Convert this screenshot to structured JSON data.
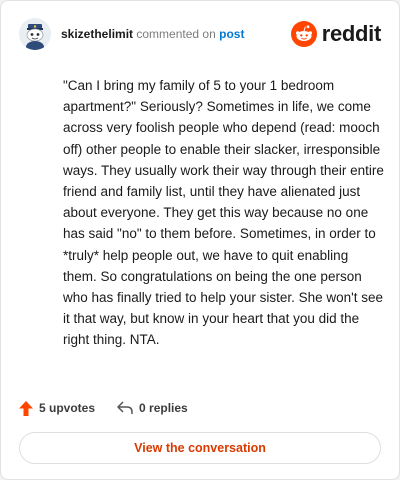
{
  "header": {
    "username": "skizethelimit",
    "action_text": "commented on",
    "post_link": "post",
    "logo_text": "reddit"
  },
  "comment": {
    "body": "\"Can I bring my family of 5 to your 1 bedroom apartment?\" Seriously? Sometimes in life, we come across very foolish people who depend (read: mooch off) other people to enable their slacker, irresponsible ways. They usually work their way through their entire friend and family list, until they have alienated just about everyone. They get this way because no one has said \"no\" to them before. Sometimes, in order to *truly* help people out, we have to quit enabling them. So congratulations on being the one person who has finally tried to help your sister. She won't see it that way, but know in your heart that you did the right thing. NTA."
  },
  "stats": {
    "upvotes_label": "5 upvotes",
    "replies_label": "0 replies"
  },
  "cta": {
    "label": "View the conversation"
  },
  "icons": {
    "avatar": "snoo-avatar-icon",
    "logo": "reddit-logo-icon",
    "upvote": "upvote-arrow-icon",
    "reply": "reply-arrow-icon"
  },
  "colors": {
    "brand": "#ff4500",
    "upvote": "#ff4500",
    "link": "#0079d3",
    "cta_text": "#d93a00"
  }
}
